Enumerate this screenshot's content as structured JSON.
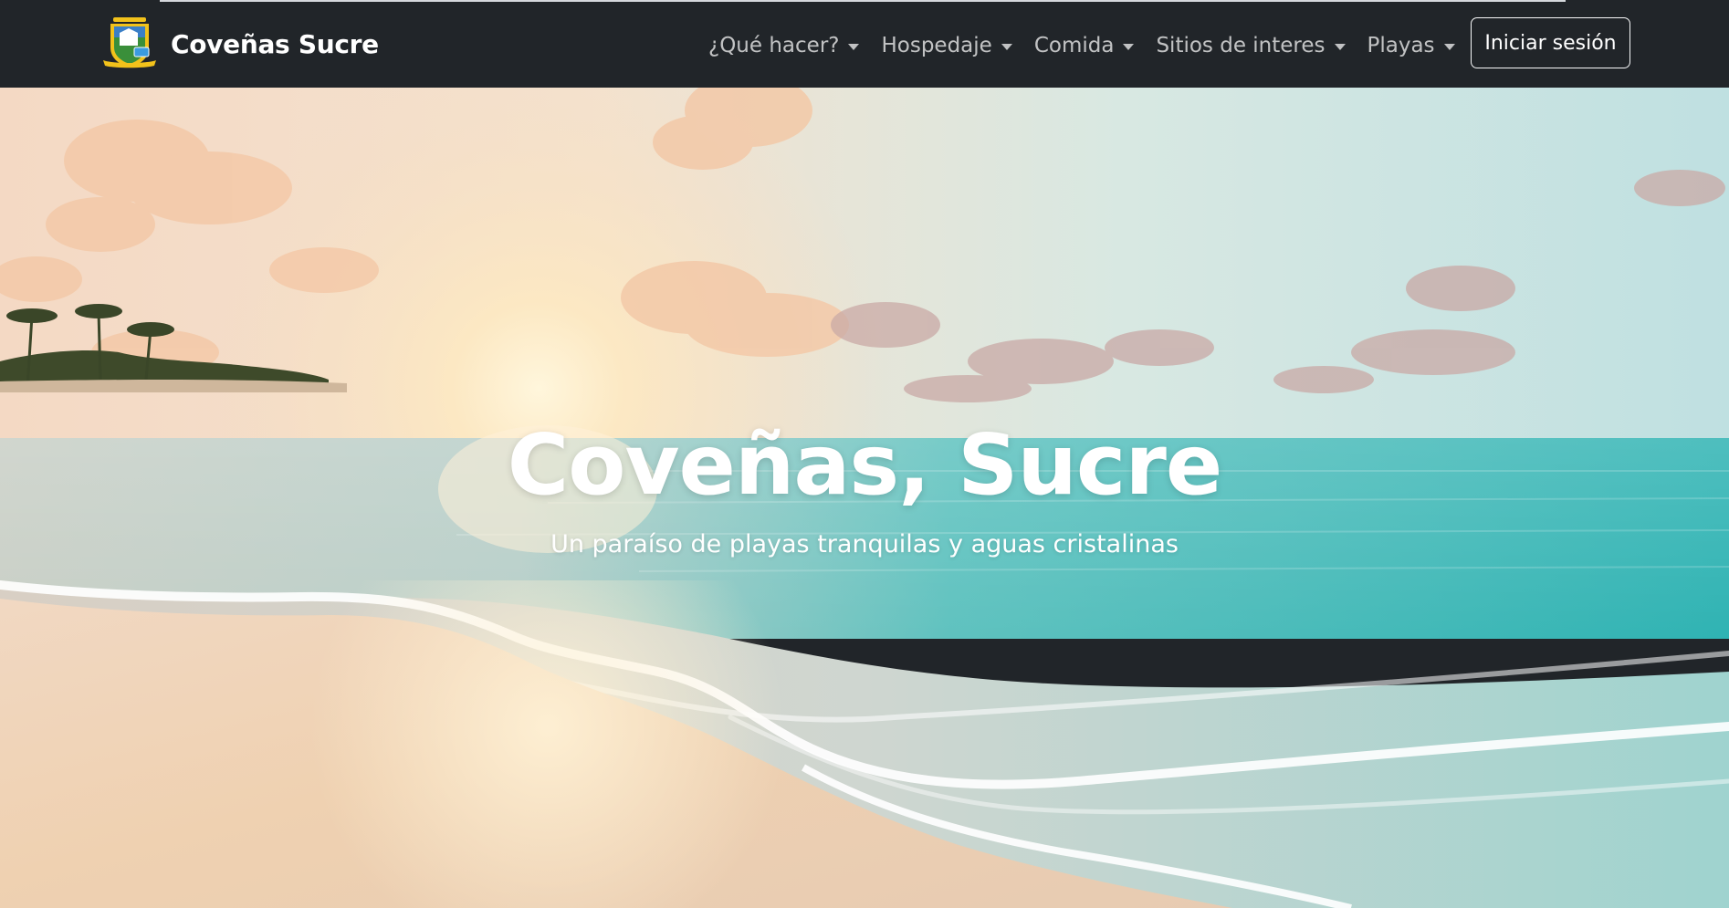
{
  "navbar": {
    "brand": {
      "logo_icon": "coat-of-arms-icon",
      "name": "Coveñas Sucre"
    },
    "menu": [
      {
        "label": "¿Qué hacer?",
        "icon": "chevron-down-icon"
      },
      {
        "label": "Hospedaje",
        "icon": "chevron-down-icon"
      },
      {
        "label": "Comida",
        "icon": "chevron-down-icon"
      },
      {
        "label": "Sitios de interes",
        "icon": "chevron-down-icon"
      },
      {
        "label": "Playas",
        "icon": "chevron-down-icon"
      }
    ],
    "login_label": "Iniciar sesión"
  },
  "hero": {
    "title": "Coveñas, Sucre",
    "subtitle": "Un paraíso de playas tranquilas y aguas cristalinas",
    "background": "beach-sunset-photo"
  },
  "colors": {
    "navbar_bg": "#212529",
    "nav_text": "#ffffffb8",
    "brand_text": "#ffffff",
    "sea": "#3fbcbc",
    "sand": "#efd2b4",
    "sky": "#cfe6e6"
  }
}
